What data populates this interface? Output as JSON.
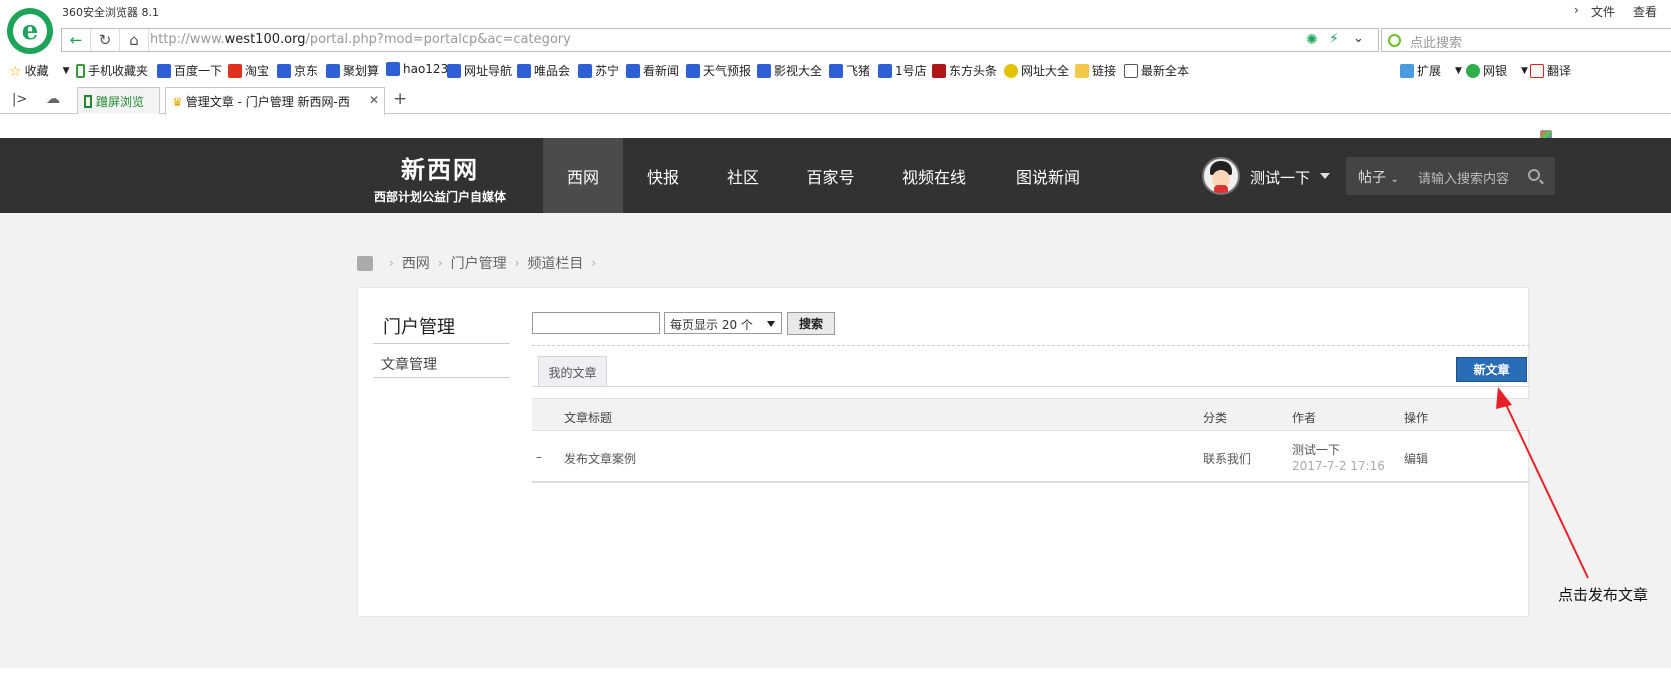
{
  "browser": {
    "window_title": "360安全浏览器 8.1",
    "menu": [
      "文件",
      "查看"
    ],
    "url_prefix": "http://www.",
    "url_domain": "west100.org",
    "url_path": "/portal.php?mod=portalcp&ac=category",
    "search_placeholder": "点此搜索",
    "bookmarks": [
      "收藏",
      "手机收藏夹",
      "百度一下",
      "淘宝",
      "京东",
      "聚划算",
      "hao123",
      "网址导航",
      "唯品会",
      "苏宁",
      "看新闻",
      "天气预报",
      "影视大全",
      "飞猪",
      "1号店",
      "东方头条",
      "网址大全",
      "链接",
      "最新全本"
    ],
    "bookmarks_right": [
      "扩展",
      "网银",
      "翻译"
    ],
    "tabs": [
      {
        "label": "蹭屏浏览"
      },
      {
        "label": "管理文章 - 门户管理 新西网-西"
      }
    ]
  },
  "site": {
    "name": "新西网",
    "tagline": "西部计划公益门户自媒体",
    "nav": [
      "西网",
      "快报",
      "社区",
      "百家号",
      "视频在线",
      "图说新闻"
    ],
    "user": "测试一下",
    "search_type": "帖子",
    "search_placeholder": "请输入搜索内容"
  },
  "breadcrumb": [
    "西网",
    "门户管理",
    "频道栏目"
  ],
  "sidebar": {
    "title": "门户管理",
    "items": [
      "文章管理"
    ]
  },
  "toolbar": {
    "per_page": "每页显示 20 个",
    "search_button": "搜索",
    "my_articles_tab": "我的文章",
    "new_article_button": "新文章"
  },
  "table": {
    "headers": [
      "文章标题",
      "分类",
      "作者",
      "操作"
    ],
    "rows": [
      {
        "marker": "–",
        "title": "发布文章案例",
        "category": "联系我们",
        "author": "测试一下",
        "date": "2017-7-2 17:16",
        "action": "编辑"
      }
    ]
  },
  "annotation": {
    "text": "点击发布文章",
    "color": "#e8202a"
  },
  "colors": {
    "header_bg": "#323232",
    "nav_active": "#4b4b4b",
    "button_blue": "#2a6db7",
    "browser_green": "#1ea45a"
  }
}
